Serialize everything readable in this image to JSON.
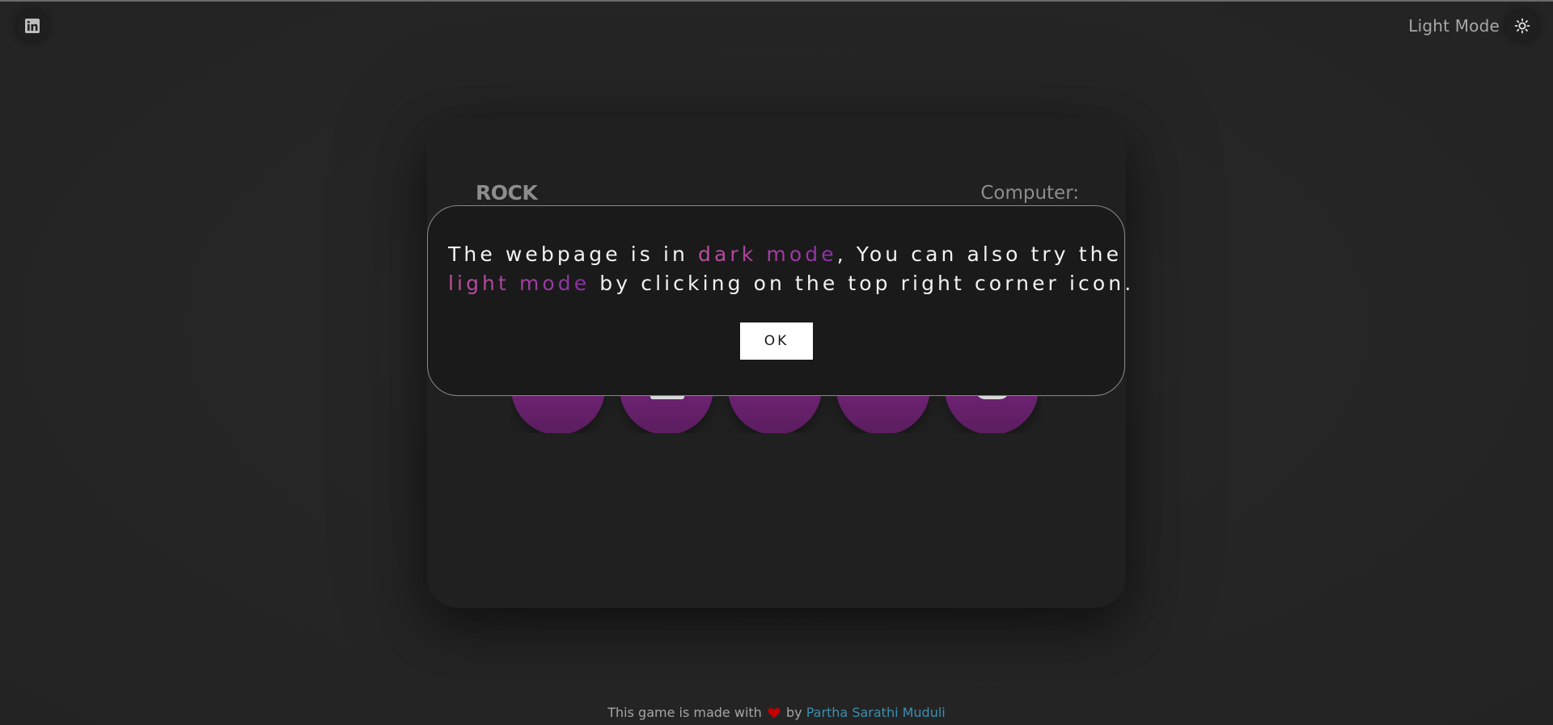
{
  "header": {
    "social_icon": "linkedin-icon",
    "mode_label": "Light Mode",
    "mode_icon": "sun-icon"
  },
  "game": {
    "player_label": "ROCK",
    "computer_label": "Computer:",
    "choice_color": "#7a2680"
  },
  "dialog": {
    "text_1": "The webpage is in ",
    "highlight_1": "dark mode",
    "text_2": ", You can also try the",
    "highlight_2": "light mode",
    "text_3": " by clicking on the top right corner icon.",
    "ok_label": "OK"
  },
  "footer": {
    "prefix": "This game is made with",
    "heart_icon": "heart-icon",
    "by": "by",
    "author": "Partha Sarathi Muduli"
  },
  "colors": {
    "background": "#242424",
    "card": "#202020",
    "dialog": "#1a1a1a",
    "accent_pink": "#c0509c",
    "accent_purple": "#8a2fa8",
    "link": "#3b8fb0",
    "heart": "#c40000"
  }
}
